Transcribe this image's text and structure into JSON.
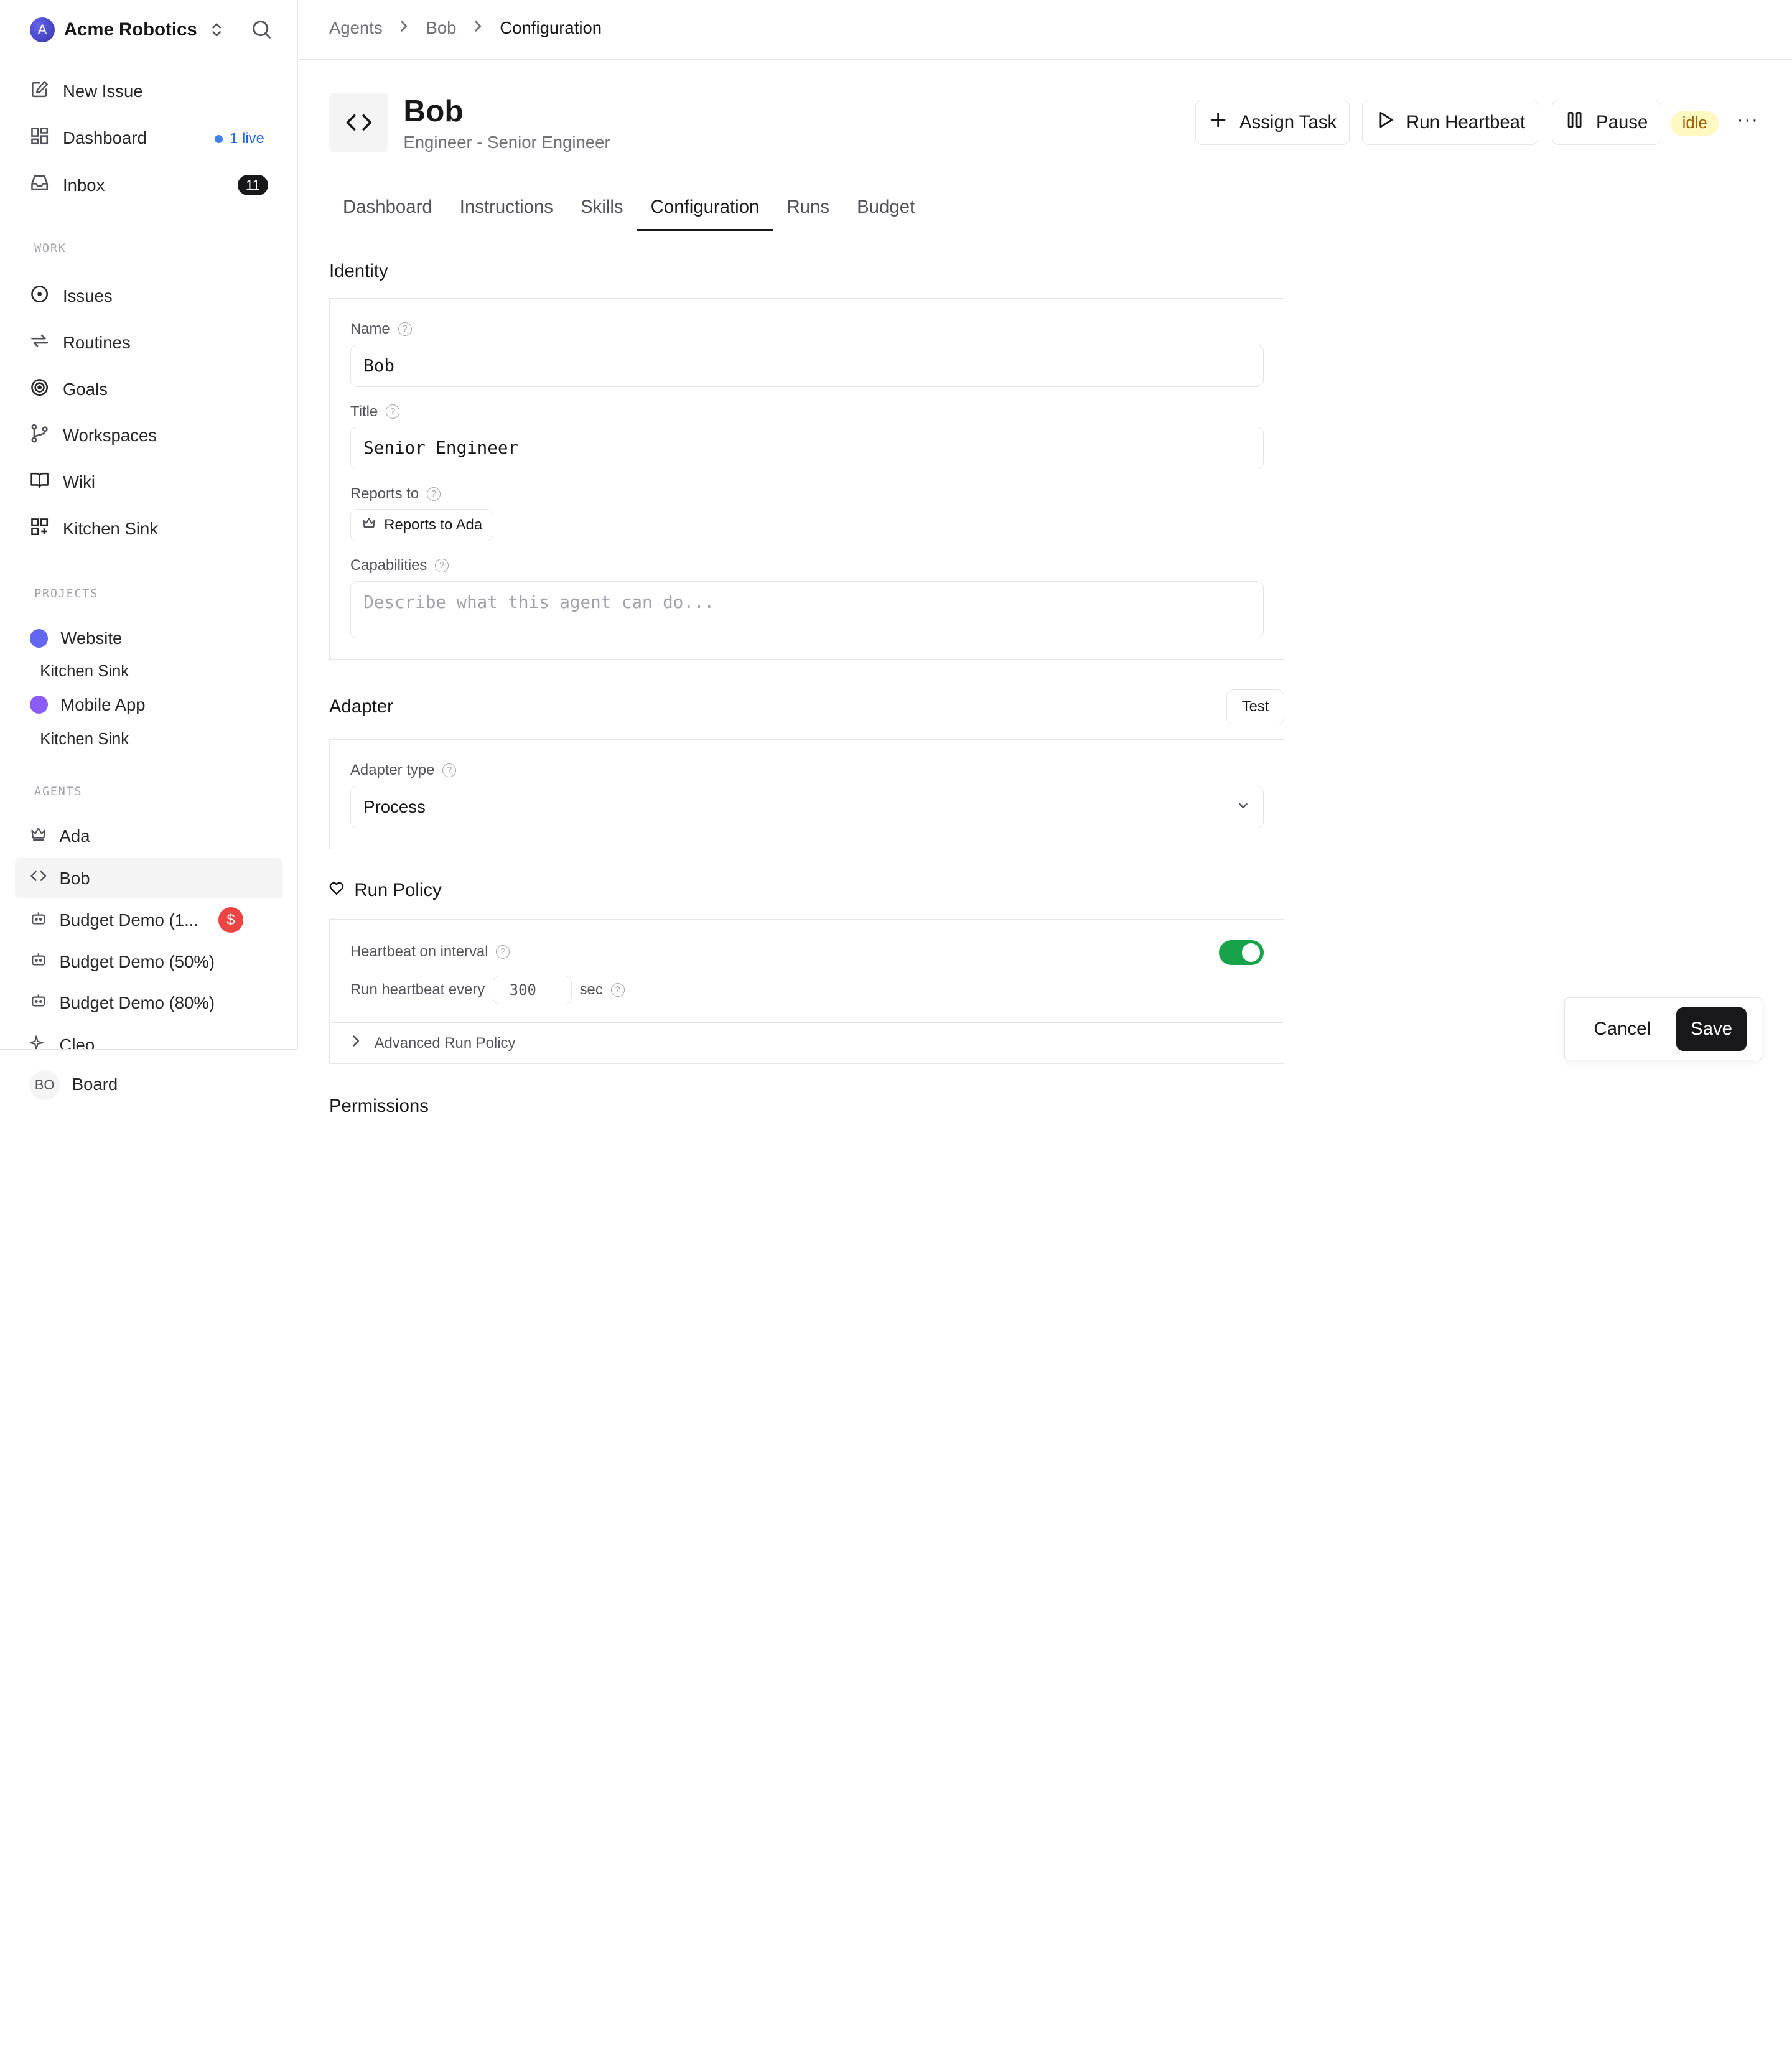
{
  "sidebar": {
    "company": {
      "logo_letter": "A",
      "name": "Acme Robotics"
    },
    "top_items": [
      {
        "label": "New Issue",
        "icon": "pencil-square-icon"
      },
      {
        "label": "Dashboard",
        "icon": "dashboard-grid-icon",
        "live_label": "1 live"
      },
      {
        "label": "Inbox",
        "icon": "inbox-icon",
        "badge": "11"
      }
    ],
    "work_label": "WORK",
    "work_items": [
      {
        "label": "Issues",
        "icon": "circle-dot-icon"
      },
      {
        "label": "Routines",
        "icon": "repeat-icon"
      },
      {
        "label": "Goals",
        "icon": "target-icon"
      },
      {
        "label": "Workspaces",
        "icon": "git-branch-icon"
      },
      {
        "label": "Wiki",
        "icon": "book-open-icon"
      },
      {
        "label": "Kitchen Sink",
        "icon": "shapes-icon"
      }
    ],
    "projects_label": "PROJECTS",
    "projects": [
      {
        "label": "Website",
        "color": "#6366f1",
        "sub": "Kitchen Sink"
      },
      {
        "label": "Mobile App",
        "color": "#8b5cf6",
        "sub": "Kitchen Sink"
      }
    ],
    "agents_label": "AGENTS",
    "agents": [
      {
        "label": "Ada",
        "icon": "crown-icon"
      },
      {
        "label": "Bob",
        "icon": "code-icon",
        "active": true
      },
      {
        "label": "Budget Demo (1...",
        "icon": "bot-icon",
        "badge": "$"
      },
      {
        "label": "Budget Demo (50%)",
        "icon": "bot-icon"
      },
      {
        "label": "Budget Demo (80%)",
        "icon": "bot-icon"
      },
      {
        "label": "Cleo",
        "icon": "sparkle-icon"
      }
    ],
    "footer": {
      "avatar": "BO",
      "label": "Board"
    }
  },
  "breadcrumb": {
    "items": [
      "Agents",
      "Bob"
    ],
    "current": "Configuration"
  },
  "agent": {
    "name": "Bob",
    "role": "Engineer - Senior Engineer",
    "status": "idle"
  },
  "actions": {
    "assign": "Assign Task",
    "heartbeat": "Run Heartbeat",
    "pause": "Pause",
    "more": "···"
  },
  "tabs": [
    "Dashboard",
    "Instructions",
    "Skills",
    "Configuration",
    "Runs",
    "Budget"
  ],
  "identity": {
    "title": "Identity",
    "name_label": "Name",
    "name_value": "Bob",
    "title_label": "Title",
    "title_value": "Senior Engineer",
    "reports_label": "Reports to",
    "reports_value": "Reports to Ada",
    "capabilities_label": "Capabilities",
    "capabilities_placeholder": "Describe what this agent can do..."
  },
  "adapter": {
    "title": "Adapter",
    "test": "Test",
    "type_label": "Adapter type",
    "type_value": "Process"
  },
  "run_policy": {
    "title": "Run Policy",
    "heartbeat_label": "Heartbeat on interval",
    "heartbeat_enabled": true,
    "every_label": "Run heartbeat every",
    "every_value": "300",
    "unit": "sec",
    "advanced": "Advanced Run Policy"
  },
  "permissions": {
    "title": "Permissions"
  },
  "footer": {
    "cancel": "Cancel",
    "save": "Save"
  }
}
